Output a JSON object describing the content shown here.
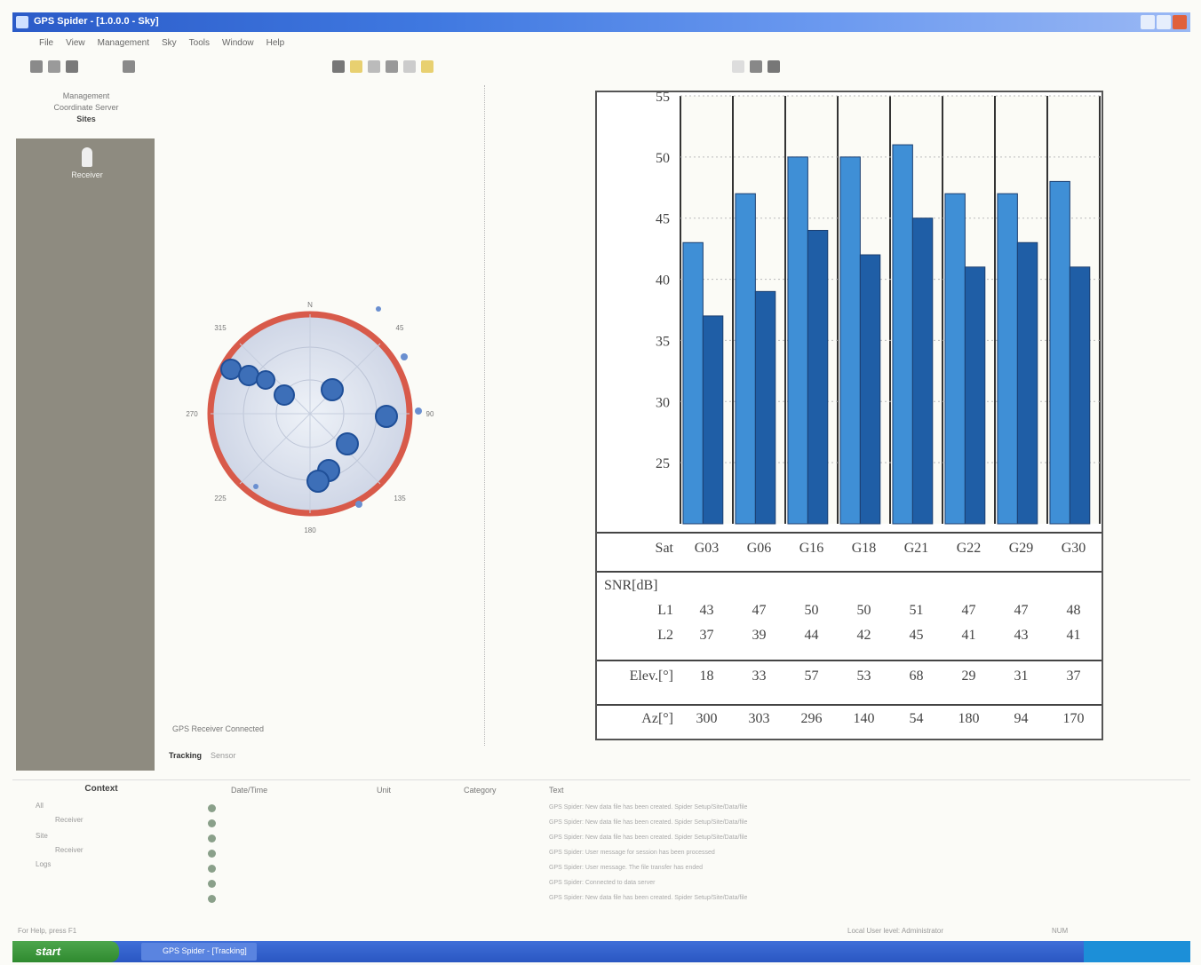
{
  "window": {
    "title": "GPS Spider - [1.0.0.0 - Sky]"
  },
  "menu": [
    "File",
    "View",
    "Management",
    "Sky",
    "Tools",
    "Window",
    "Help"
  ],
  "left_panel": {
    "header_lines": [
      "Management",
      "Coordinate Server"
    ],
    "selected": "Sites",
    "item_label": "Receiver"
  },
  "sky_plot": {
    "cardinals": {
      "n": "N",
      "e": "90",
      "s": "180",
      "w": "270"
    },
    "diagonals": {
      "ne": "45",
      "se": "135",
      "sw": "225",
      "nw": "315"
    },
    "status": "GPS Receiver  Connected"
  },
  "tabs": [
    {
      "label": "Tracking",
      "active": true
    },
    {
      "label": "Sensor",
      "active": false
    }
  ],
  "chart_data": {
    "type": "bar",
    "categories": [
      "G03",
      "G06",
      "G16",
      "G18",
      "G21",
      "G22",
      "G29",
      "G30"
    ],
    "series": [
      {
        "name": "L1",
        "values": [
          43,
          47,
          50,
          50,
          51,
          47,
          47,
          48
        ],
        "color": "#3f8fd6"
      },
      {
        "name": "L2",
        "values": [
          37,
          39,
          44,
          42,
          45,
          41,
          43,
          41
        ],
        "color": "#1f5ea6"
      }
    ],
    "ylim": [
      20,
      55
    ],
    "yticks": [
      25,
      30,
      35,
      40,
      45,
      50,
      55
    ],
    "grid": true,
    "table": {
      "sat_label": "Sat",
      "snr_label": "SNR[dB]",
      "l1_label": "L1",
      "l2_label": "L2",
      "elev_label": "Elev.[°]",
      "az_label": "Az[°]",
      "elevation": [
        18,
        33,
        57,
        53,
        68,
        29,
        31,
        37
      ],
      "azimuth": [
        300,
        303,
        296,
        140,
        54,
        180,
        94,
        170
      ]
    }
  },
  "context": {
    "title": "Context",
    "items": [
      "All",
      "Receiver",
      "Site",
      "Receiver",
      "Logs"
    ]
  },
  "log": {
    "headers": [
      "Date/Time",
      "Unit",
      "Category",
      "Text"
    ],
    "rows": [
      {
        "text": "GPS Spider: New data file has been created. Spider Setup/Site/Data/file"
      },
      {
        "text": "GPS Spider: New data file has been created. Spider Setup/Site/Data/file"
      },
      {
        "text": "GPS Spider: New data file has been created. Spider Setup/Site/Data/file"
      },
      {
        "text": "GPS Spider: User message for session has been processed"
      },
      {
        "text": "GPS Spider: User message. The file transfer has ended"
      },
      {
        "text": "GPS Spider: Connected to data server"
      },
      {
        "text": "GPS Spider: New data file has been created. Spider Setup/Site/Data/file"
      }
    ]
  },
  "status_bar": {
    "left": "For Help, press F1",
    "middle": "Local   User level: Administrator",
    "num": "NUM"
  },
  "taskbar": {
    "start": "start",
    "item": "GPS Spider - [Tracking]"
  }
}
